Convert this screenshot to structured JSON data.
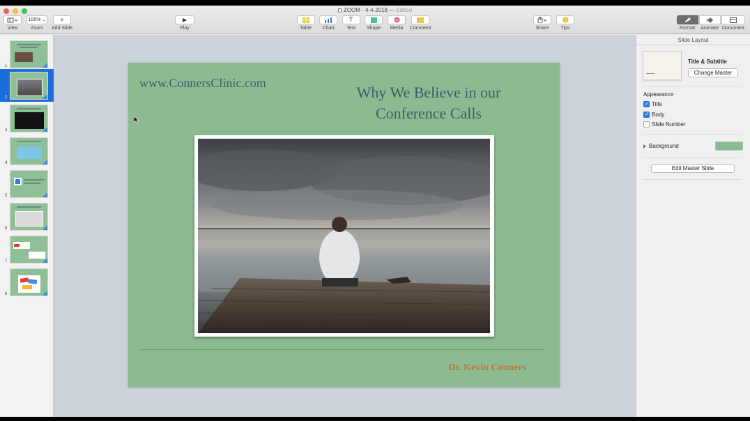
{
  "window": {
    "title": "ZOOM - 4-4-2018",
    "status": "Edited"
  },
  "toolbar": {
    "view_label": "View",
    "zoom_value": "100%",
    "zoom_label": "Zoom",
    "add_slide_label": "Add Slide",
    "play_label": "Play",
    "table_label": "Table",
    "chart_label": "Chart",
    "text_label": "Text",
    "shape_label": "Shape",
    "media_label": "Media",
    "comment_label": "Comment",
    "share_label": "Share",
    "tips_label": "Tips",
    "format_label": "Format",
    "animate_label": "Animate",
    "document_label": "Document"
  },
  "navigator": {
    "slides": [
      {
        "num": "1"
      },
      {
        "num": "2"
      },
      {
        "num": "3"
      },
      {
        "num": "4"
      },
      {
        "num": "5"
      },
      {
        "num": "6"
      },
      {
        "num": "7"
      },
      {
        "num": "8"
      }
    ],
    "selected_index": 1
  },
  "slide": {
    "url": "www.ConnersClinic.com",
    "title": "Why We Believe in our Conference Calls",
    "author": "Dr. Kevin Conners",
    "background_color": "#8cbb92"
  },
  "inspector": {
    "header": "Slide Layout",
    "master_name": "Title & Subtitle",
    "change_master_label": "Change Master",
    "appearance_label": "Appearance",
    "title_checkbox_label": "Title",
    "body_checkbox_label": "Body",
    "slide_number_checkbox_label": "Slide Number",
    "title_checked": true,
    "body_checked": true,
    "slide_number_checked": false,
    "background_label": "Background",
    "background_color": "#8cbb92",
    "edit_master_label": "Edit Master Slide"
  }
}
